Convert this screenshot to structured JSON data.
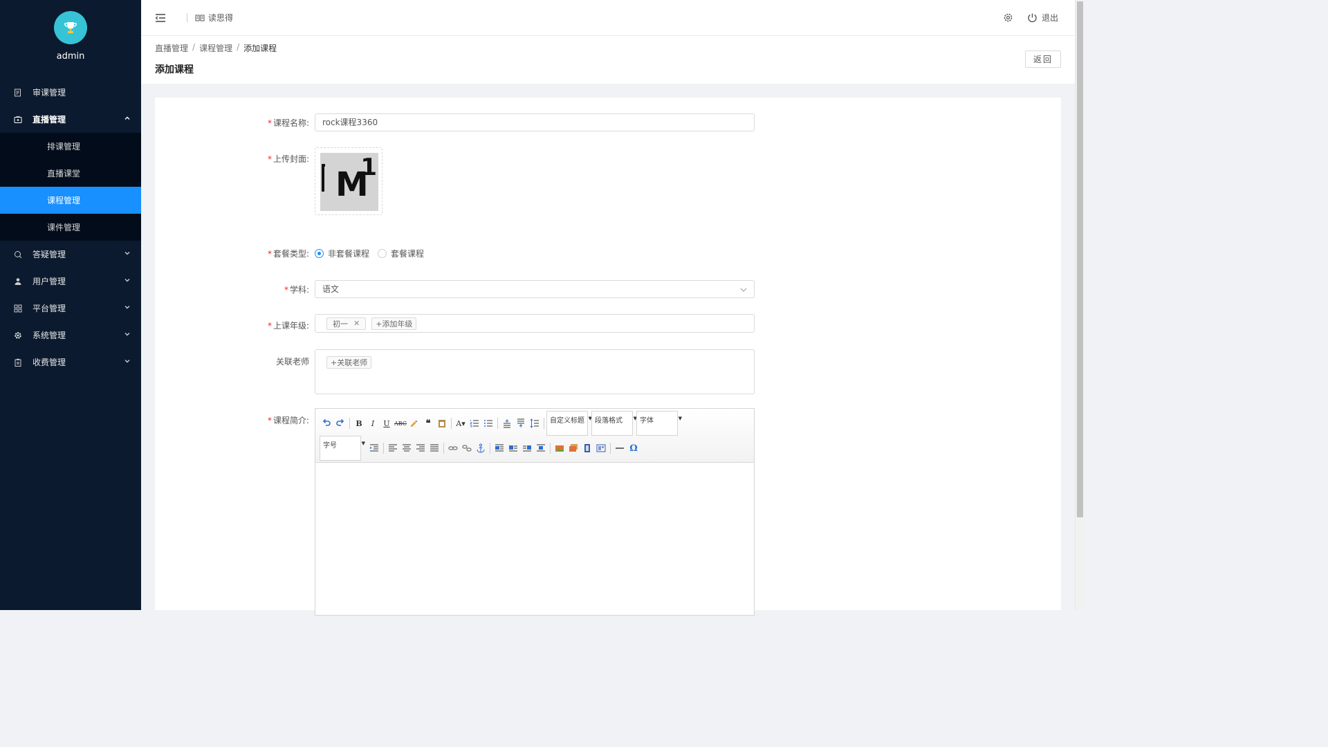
{
  "sidebar": {
    "username": "admin",
    "menu": [
      {
        "label": "审课管理",
        "icon": "review-icon"
      },
      {
        "label": "直播管理",
        "icon": "live-icon",
        "expanded": true,
        "children": [
          {
            "label": "排课管理"
          },
          {
            "label": "直播课堂"
          },
          {
            "label": "课程管理",
            "active": true
          },
          {
            "label": "课件管理"
          }
        ]
      },
      {
        "label": "答疑管理",
        "icon": "qa-icon"
      },
      {
        "label": "用户管理",
        "icon": "user-icon"
      },
      {
        "label": "平台管理",
        "icon": "grid-icon"
      },
      {
        "label": "系统管理",
        "icon": "gear-icon"
      },
      {
        "label": "收费管理",
        "icon": "clipboard-icon"
      }
    ]
  },
  "header": {
    "brand": "读思得",
    "logout_label": "退出"
  },
  "page": {
    "breadcrumb": [
      "直播管理",
      "课程管理",
      "添加课程"
    ],
    "title": "添加课程",
    "back_label": "返回"
  },
  "form": {
    "course_name": {
      "label": "课程名称:",
      "value": "rock课程3360"
    },
    "cover": {
      "label": "上传封面:"
    },
    "package_type": {
      "label": "套餐类型:",
      "options": [
        "非套餐课程",
        "套餐课程"
      ],
      "selected": "非套餐课程"
    },
    "subject": {
      "label": "学科:",
      "value": "语文"
    },
    "grade": {
      "label": "上课年级:",
      "tags": [
        "初一"
      ],
      "add_label": "+添加年级"
    },
    "teacher": {
      "label": "关联老师",
      "add_label": "+关联老师"
    },
    "intro": {
      "label": "课程简介:"
    }
  },
  "editor": {
    "custom_title": "自定义标题",
    "paragraph": "段落格式",
    "font_family": "字体",
    "font_size": "字号"
  },
  "colors": {
    "sidebar_bg": "#0b1a2e",
    "submenu_bg": "#020c1b",
    "accent": "#1890ff",
    "required": "#f5222d"
  }
}
